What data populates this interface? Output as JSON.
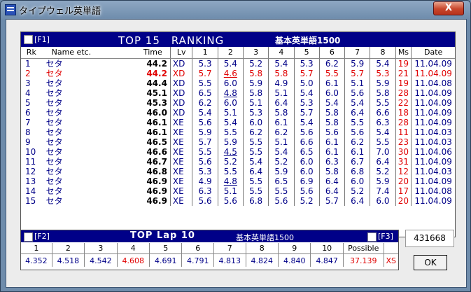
{
  "window": {
    "title": "タイプウェル英単語",
    "close_symbol": "X"
  },
  "ranking": {
    "tag": "[F1]",
    "title": "TOP 15　RANKING",
    "subtitle": "基本英単語1500",
    "columns": [
      "Rk",
      "Name etc.",
      "Time",
      "Lv",
      "1",
      "2",
      "3",
      "4",
      "5",
      "6",
      "7",
      "8",
      "Ms",
      "Date"
    ],
    "rows": [
      {
        "rk": "1",
        "name": "セタ",
        "time": "44.2",
        "lv": "XD",
        "laps": [
          "5.3",
          "5.4",
          "5.2",
          "5.4",
          "5.3",
          "6.2",
          "5.9",
          "5.4"
        ],
        "ms": "19",
        "date": "11.04.09"
      },
      {
        "rk": "2",
        "name": "セタ",
        "time": "44.2",
        "lv": "XD",
        "laps": [
          "5.7",
          "4.6",
          "5.8",
          "5.8",
          "5.7",
          "5.5",
          "5.7",
          "5.3"
        ],
        "ms": "21",
        "date": "11.04.09"
      },
      {
        "rk": "3",
        "name": "セタ",
        "time": "44.4",
        "lv": "XD",
        "laps": [
          "5.5",
          "6.0",
          "5.9",
          "4.9",
          "5.0",
          "6.1",
          "5.1",
          "5.9"
        ],
        "ms": "19",
        "date": "11.04.08"
      },
      {
        "rk": "4",
        "name": "セタ",
        "time": "45.1",
        "lv": "XD",
        "laps": [
          "6.5",
          "4.8",
          "5.8",
          "5.1",
          "5.4",
          "6.0",
          "5.6",
          "5.8"
        ],
        "ms": "28",
        "date": "11.04.09"
      },
      {
        "rk": "5",
        "name": "セタ",
        "time": "45.3",
        "lv": "XD",
        "laps": [
          "6.2",
          "6.0",
          "5.1",
          "6.4",
          "5.3",
          "5.4",
          "5.4",
          "5.5"
        ],
        "ms": "22",
        "date": "11.04.09"
      },
      {
        "rk": "6",
        "name": "セタ",
        "time": "46.0",
        "lv": "XD",
        "laps": [
          "5.4",
          "5.1",
          "5.3",
          "5.8",
          "5.7",
          "5.8",
          "6.4",
          "6.6"
        ],
        "ms": "18",
        "date": "11.04.09"
      },
      {
        "rk": "7",
        "name": "セタ",
        "time": "46.1",
        "lv": "XE",
        "laps": [
          "5.6",
          "5.4",
          "6.0",
          "6.1",
          "5.4",
          "5.8",
          "5.5",
          "6.3"
        ],
        "ms": "28",
        "date": "11.04.09"
      },
      {
        "rk": "8",
        "name": "セタ",
        "time": "46.1",
        "lv": "XE",
        "laps": [
          "5.9",
          "5.5",
          "6.2",
          "6.2",
          "5.6",
          "5.6",
          "5.6",
          "5.4"
        ],
        "ms": "11",
        "date": "11.04.03"
      },
      {
        "rk": "9",
        "name": "セタ",
        "time": "46.5",
        "lv": "XE",
        "laps": [
          "5.7",
          "5.9",
          "5.5",
          "5.1",
          "6.6",
          "6.1",
          "6.2",
          "5.5"
        ],
        "ms": "23",
        "date": "11.04.03"
      },
      {
        "rk": "10",
        "name": "セタ",
        "time": "46.6",
        "lv": "XE",
        "laps": [
          "5.5",
          "4.5",
          "5.5",
          "5.4",
          "6.5",
          "6.1",
          "6.1",
          "7.0"
        ],
        "ms": "30",
        "date": "11.04.06"
      },
      {
        "rk": "11",
        "name": "セタ",
        "time": "46.7",
        "lv": "XE",
        "laps": [
          "5.6",
          "5.2",
          "5.4",
          "5.2",
          "6.0",
          "6.3",
          "6.7",
          "6.4"
        ],
        "ms": "31",
        "date": "11.04.09"
      },
      {
        "rk": "12",
        "name": "セタ",
        "time": "46.8",
        "lv": "XE",
        "laps": [
          "5.3",
          "5.5",
          "6.4",
          "5.9",
          "6.0",
          "5.8",
          "6.8",
          "5.2"
        ],
        "ms": "12",
        "date": "11.04.03"
      },
      {
        "rk": "13",
        "name": "セタ",
        "time": "46.9",
        "lv": "XE",
        "laps": [
          "4.9",
          "4.8",
          "5.5",
          "6.5",
          "6.9",
          "6.4",
          "6.0",
          "5.9"
        ],
        "ms": "20",
        "date": "11.04.09"
      },
      {
        "rk": "14",
        "name": "セタ",
        "time": "46.9",
        "lv": "XE",
        "laps": [
          "6.3",
          "5.1",
          "5.5",
          "5.5",
          "5.6",
          "6.4",
          "5.2",
          "7.4"
        ],
        "ms": "17",
        "date": "11.04.08"
      },
      {
        "rk": "15",
        "name": "セタ",
        "time": "46.9",
        "lv": "XE",
        "laps": [
          "5.6",
          "5.6",
          "6.8",
          "5.6",
          "5.2",
          "5.7",
          "6.4",
          "6.0"
        ],
        "ms": "20",
        "date": "11.04.09"
      }
    ]
  },
  "top_lap": {
    "tag_left": "[F2]",
    "title": "TOP Lap 10",
    "subtitle": "基本英単語1500",
    "tag_right": "[F3]",
    "headers": [
      "1",
      "2",
      "3",
      "4",
      "5",
      "6",
      "7",
      "8",
      "9",
      "10",
      "Possible"
    ],
    "values": [
      "4.352",
      "4.518",
      "4.542",
      "4.608",
      "4.691",
      "4.791",
      "4.813",
      "4.824",
      "4.840",
      "4.847",
      "37.139"
    ],
    "level": "XS"
  },
  "score": "431668",
  "ok_label": "OK",
  "colors": {
    "header_bg": "#000088",
    "text_blue": "#000088",
    "highlight_red": "#e00000"
  }
}
